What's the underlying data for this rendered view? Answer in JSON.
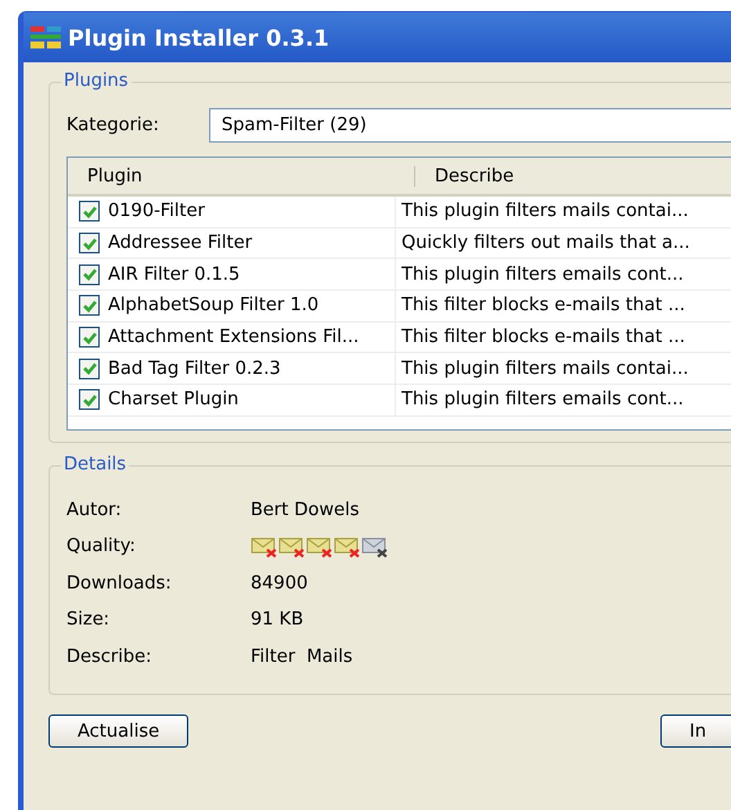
{
  "window": {
    "title": "Plugin Installer 0.3.1"
  },
  "plugins": {
    "legend": "Plugins",
    "category_label": "Kategorie:",
    "category_value": "Spam-Filter (29)",
    "table": {
      "columns": [
        "Plugin",
        "Describe"
      ],
      "rows": [
        {
          "name": "0190-Filter",
          "describe": "This plugin filters mails contai...",
          "checked": true
        },
        {
          "name": "Addressee Filter",
          "describe": "Quickly filters out mails that a...",
          "checked": true
        },
        {
          "name": "AIR Filter 0.1.5",
          "describe": "This plugin filters emails cont...",
          "checked": true
        },
        {
          "name": "AlphabetSoup Filter 1.0",
          "describe": "This filter blocks e-mails that ...",
          "checked": true
        },
        {
          "name": "Attachment Extensions Fil...",
          "describe": "This filter blocks e-mails that ...",
          "checked": true
        },
        {
          "name": "Bad Tag Filter 0.2.3",
          "describe": "This plugin filters mails contai...",
          "checked": true
        },
        {
          "name": "Charset Plugin",
          "describe": "This plugin filters emails cont...",
          "checked": true
        }
      ]
    }
  },
  "details": {
    "legend": "Details",
    "fields": [
      {
        "kind": "text",
        "label": "Autor:",
        "value": "Bert Dowels"
      },
      {
        "kind": "rating",
        "label": "Quality:",
        "stars": 4
      },
      {
        "kind": "text",
        "label": "Downloads:",
        "value": "84900"
      },
      {
        "kind": "text",
        "label": "Size:",
        "value": "91 KB"
      },
      {
        "kind": "text",
        "label": "Describe:",
        "value": "Filter  Mails"
      }
    ]
  },
  "buttons": [
    "Actualise",
    "In"
  ]
}
